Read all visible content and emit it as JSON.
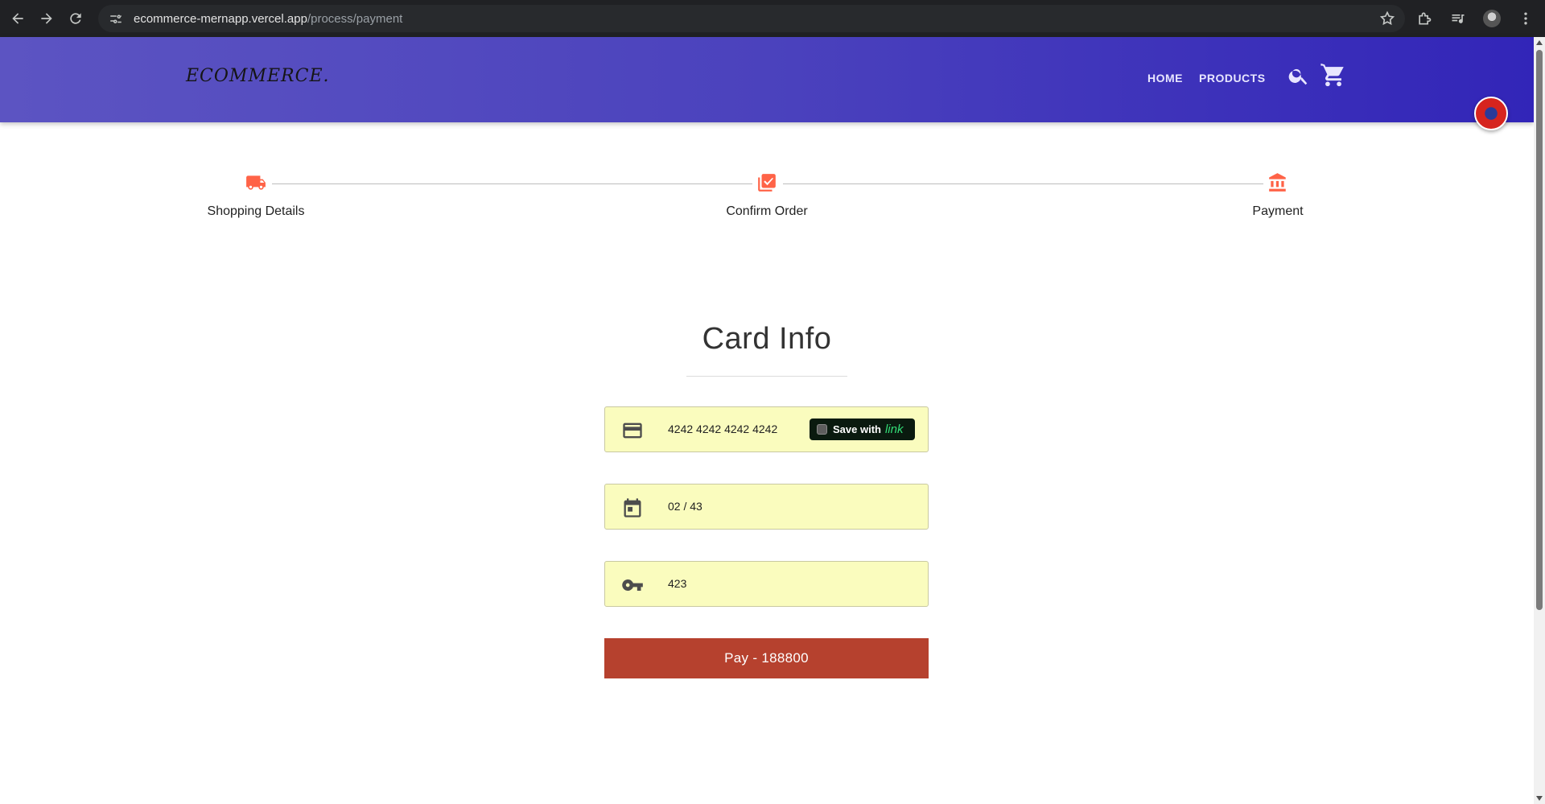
{
  "browser": {
    "url_host": "ecommerce-mernapp.vercel.app",
    "url_path": "/process/payment"
  },
  "header": {
    "logo": "ECOMMERCE.",
    "nav": [
      {
        "label": "HOME"
      },
      {
        "label": "PRODUCTS"
      }
    ]
  },
  "stepper": {
    "steps": [
      {
        "label": "Shopping Details",
        "icon": "truck-icon"
      },
      {
        "label": "Confirm Order",
        "icon": "checklist-icon"
      },
      {
        "label": "Payment",
        "icon": "bank-icon"
      }
    ],
    "active_color": "#ff6347"
  },
  "card": {
    "title": "Card Info",
    "card_number": "4242 4242 4242 4242",
    "expiry": "02 / 43",
    "cvc": "423",
    "save_with": "Save with",
    "save_brand": "link",
    "pay_label": "Pay - 188800"
  },
  "colors": {
    "header_start": "#5c54c2",
    "header_end": "#3225b8",
    "field_bg": "#fafcbe",
    "pay_button": "#b6412e"
  }
}
